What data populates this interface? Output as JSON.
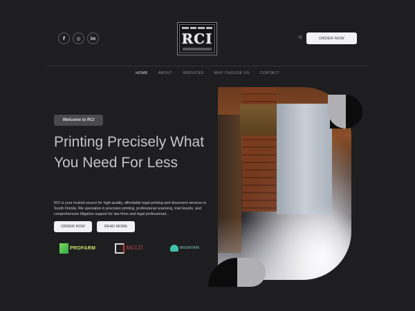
{
  "header": {
    "socials": [
      {
        "icon": "facebook-icon",
        "glyph": "f"
      },
      {
        "icon": "instagram-icon",
        "glyph": "◎"
      },
      {
        "icon": "linkedin-icon",
        "glyph": "in"
      }
    ],
    "logo_text": "RCI",
    "theme_toggle_icon": "sun-icon",
    "order_button": "ORDER NOW"
  },
  "nav": {
    "items": [
      "HOME",
      "ABOUT",
      "SERVICES",
      "WHY CHOOSE US",
      "CONTACT"
    ],
    "active": "HOME"
  },
  "hero": {
    "badge": "Welcome to RCI",
    "headline": "Printing Precisely What You Need For Less",
    "description": "RCI is your trusted source for high-quality, affordable legal printing and document services in South Florida. We specialize in precision printing, professional scanning, trial boards, and comprehensive litigation support for law firms and legal professional...",
    "primary_button": "ORDER NOW",
    "secondary_button": "READ MORE"
  },
  "partners": [
    {
      "name": "PROFARM",
      "icon": "leaf-logo-icon"
    },
    {
      "name": "MULTI",
      "icon": "m-logo-icon"
    },
    {
      "name": "MOUNTAIN",
      "icon": "mountain-logo-icon"
    }
  ],
  "colors": {
    "background": "#1e1e20",
    "button": "#f2f2f4",
    "badge": "#4a4a4e"
  }
}
